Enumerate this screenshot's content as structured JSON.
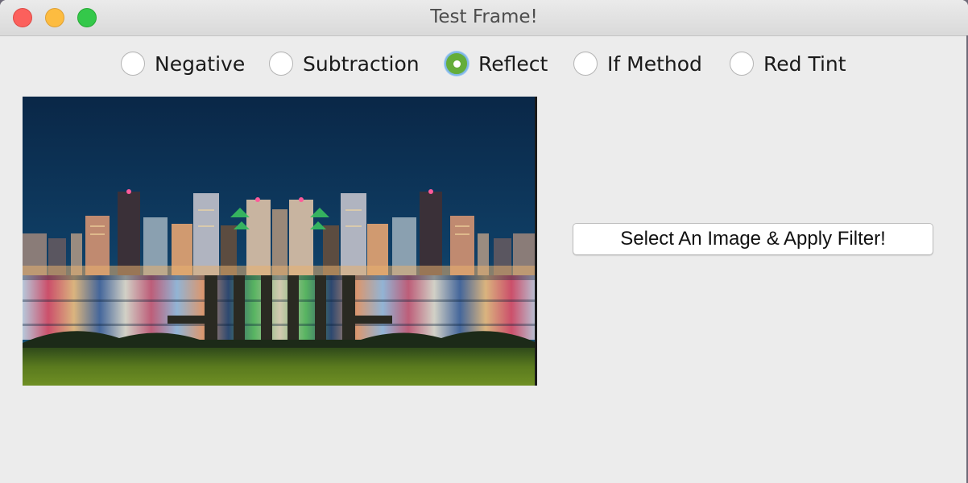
{
  "window": {
    "title": "Test Frame!"
  },
  "filters": {
    "options": [
      {
        "label": "Negative",
        "selected": false
      },
      {
        "label": "Subtraction",
        "selected": false
      },
      {
        "label": "Reflect",
        "selected": true
      },
      {
        "label": "If Method",
        "selected": false
      },
      {
        "label": "Red Tint",
        "selected": false
      }
    ]
  },
  "preview": {
    "description_icon": "city-skyline-reflection-image"
  },
  "actions": {
    "apply_label": "Select An Image & Apply Filter!"
  },
  "colors": {
    "selected_radio": "#64ad3a",
    "focus_ring": "#7fb6e6"
  }
}
